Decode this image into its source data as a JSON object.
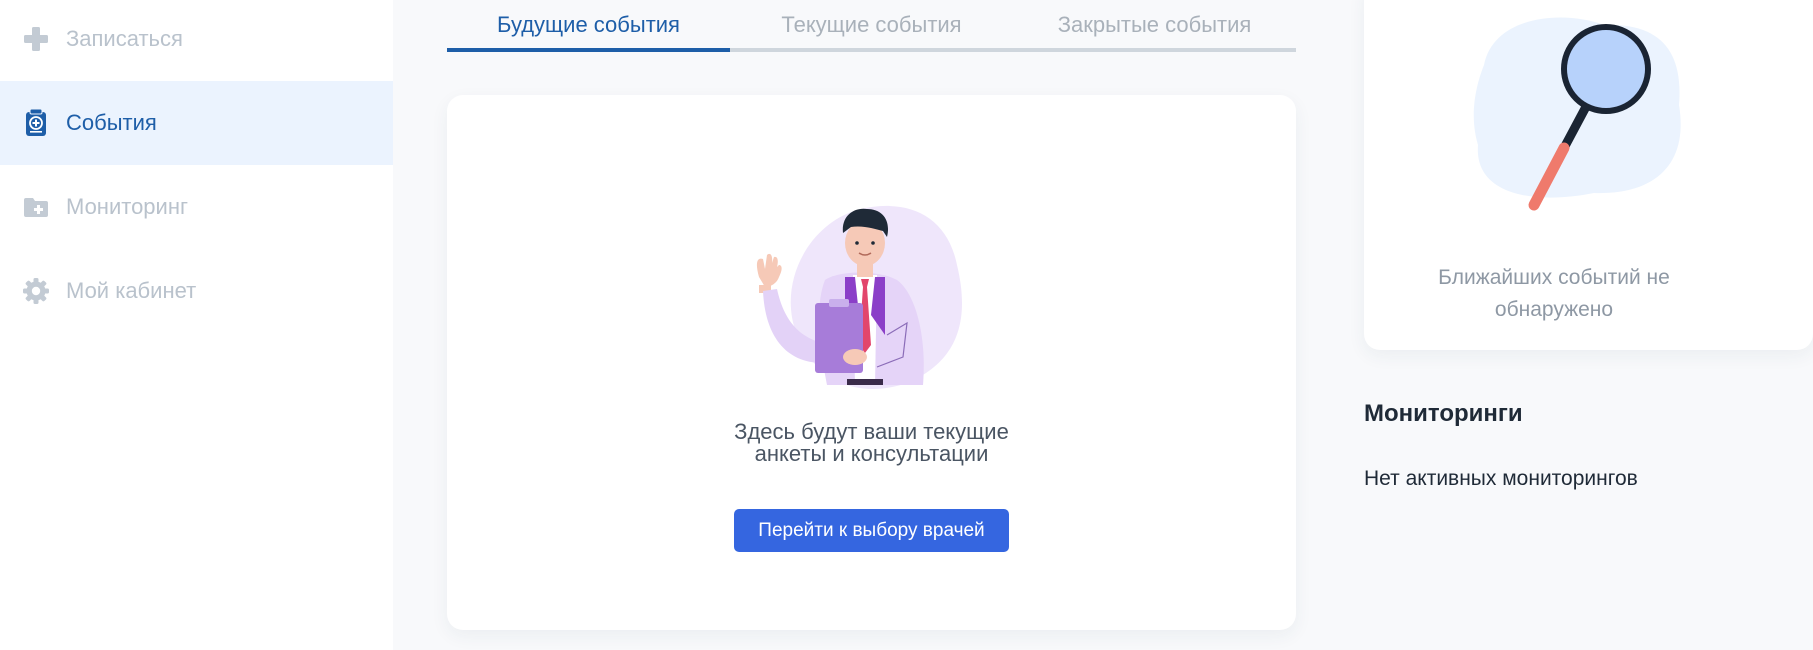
{
  "sidebar": {
    "items": [
      {
        "label": "Записаться",
        "icon": "plus-icon",
        "active": false
      },
      {
        "label": "События",
        "icon": "calendar-book-icon",
        "active": true
      },
      {
        "label": "Мониторинг",
        "icon": "folder-plus-icon",
        "active": false
      },
      {
        "label": "Мой кабинет",
        "icon": "gear-icon",
        "active": false
      }
    ]
  },
  "tabs": [
    {
      "label": "Будущие события",
      "active": true
    },
    {
      "label": "Текущие события",
      "active": false
    },
    {
      "label": "Закрытые события",
      "active": false
    }
  ],
  "main": {
    "empty_line1": "Здесь будут ваши текущие",
    "empty_line2": "анкеты и консультации",
    "cta_label": "Перейти к выбору врачей",
    "illustration": "doctor-waving-illustration"
  },
  "right": {
    "nearby_line1": "Ближайших событий не",
    "nearby_line2": "обнаружено",
    "monitorings_title": "Мониторинги",
    "monitorings_empty": "Нет активных мониторингов",
    "illustration": "magnifier-illustration"
  },
  "colors": {
    "accent": "#1e5ea8",
    "active_bg": "#ebf3fe",
    "button": "#3566e0",
    "muted": "#b9c2cc"
  }
}
